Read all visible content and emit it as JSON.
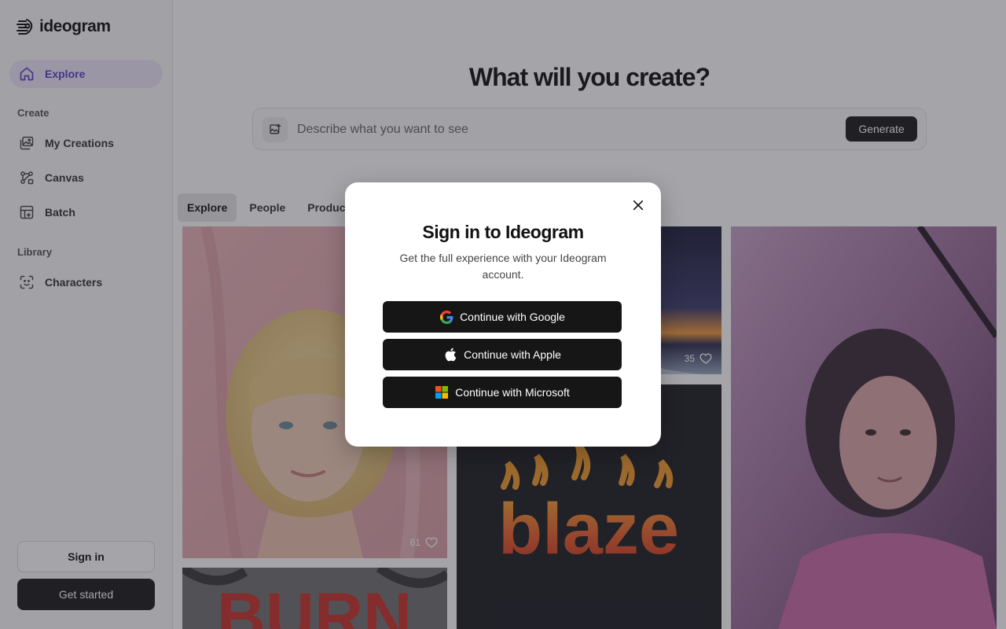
{
  "app": {
    "name": "ideogram"
  },
  "sidebar": {
    "explore_label": "Explore",
    "create_section": "Create",
    "create_items": [
      {
        "label": "My Creations",
        "icon": "images-icon"
      },
      {
        "label": "Canvas",
        "icon": "canvas-icon"
      },
      {
        "label": "Batch",
        "icon": "batch-icon"
      }
    ],
    "library_section": "Library",
    "library_items": [
      {
        "label": "Characters",
        "icon": "character-icon"
      }
    ],
    "signin_label": "Sign in",
    "get_started_label": "Get started"
  },
  "main": {
    "headline": "What will you create?",
    "prompt_placeholder": "Describe what you want to see",
    "generate_label": "Generate",
    "tabs": [
      "Explore",
      "People",
      "Product"
    ],
    "cards": [
      {
        "likes": "61",
        "subject": "portrait-blonde-woman"
      },
      {
        "likes": "35",
        "subject": "sunset-seascape"
      },
      {
        "likes": "",
        "subject": "blaze-fire-text"
      },
      {
        "likes": "",
        "subject": "portrait-woman-pink"
      },
      {
        "likes": "",
        "subject": "burn-fire-text"
      }
    ],
    "blaze_text": "blaze",
    "burn_text": "BURN"
  },
  "modal": {
    "title": "Sign in to Ideogram",
    "subtitle": "Get the full experience with your Ideogram account.",
    "google_label": "Continue with Google",
    "apple_label": "Continue with Apple",
    "microsoft_label": "Continue with Microsoft"
  },
  "colors": {
    "accent": "#5a3fc0",
    "accent_bg": "#ece6f8",
    "dark_button": "#161616"
  }
}
